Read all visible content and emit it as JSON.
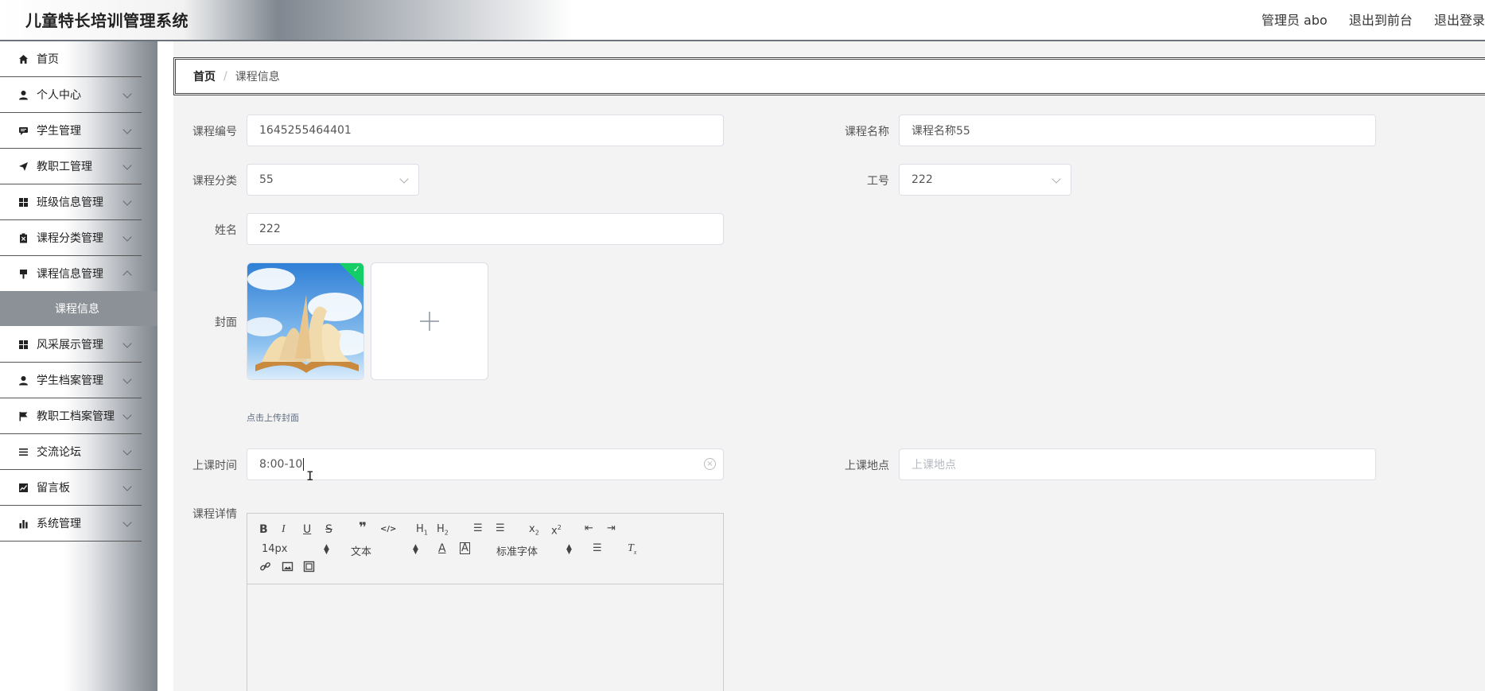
{
  "header": {
    "title": "儿童特长培训管理系统",
    "user": "管理员 abo",
    "to_front": "退出到前台",
    "logout": "退出登录"
  },
  "sidebar": {
    "items": [
      {
        "label": "首页",
        "icon": "home-icon"
      },
      {
        "label": "个人中心",
        "icon": "user-icon"
      },
      {
        "label": "学生管理",
        "icon": "chat-icon"
      },
      {
        "label": "教职工管理",
        "icon": "send-icon"
      },
      {
        "label": "班级信息管理",
        "icon": "grid-icon"
      },
      {
        "label": "课程分类管理",
        "icon": "clipboard-icon"
      },
      {
        "label": "课程信息管理",
        "icon": "brush-icon"
      },
      {
        "label": "风采展示管理",
        "icon": "grid-icon"
      },
      {
        "label": "学生档案管理",
        "icon": "user-icon"
      },
      {
        "label": "教职工档案管理",
        "icon": "flag-icon"
      },
      {
        "label": "交流论坛",
        "icon": "list-icon"
      },
      {
        "label": "留言板",
        "icon": "chart-icon"
      },
      {
        "label": "系统管理",
        "icon": "bar-chart-icon"
      }
    ],
    "active_sub": "课程信息"
  },
  "breadcrumb": {
    "home": "首页",
    "sep": "/",
    "current": "课程信息"
  },
  "form": {
    "course_no_label": "课程编号",
    "course_no_value": "1645255464401",
    "course_name_label": "课程名称",
    "course_name_value": "课程名称55",
    "category_label": "课程分类",
    "category_value": "55",
    "staff_no_label": "工号",
    "staff_no_value": "222",
    "name_label": "姓名",
    "name_value": "222",
    "cover_label": "封面",
    "upload_tip": "点击上传封面",
    "time_label": "上课时间",
    "time_value": "8:00-10",
    "place_label": "上课地点",
    "place_placeholder": "上课地点",
    "detail_label": "课程详情"
  },
  "editor": {
    "font_size": "14px",
    "text_type": "文本",
    "font_family": "标准字体"
  },
  "colors": {
    "success": "#13ce66",
    "active_menu": "#8c9198"
  }
}
